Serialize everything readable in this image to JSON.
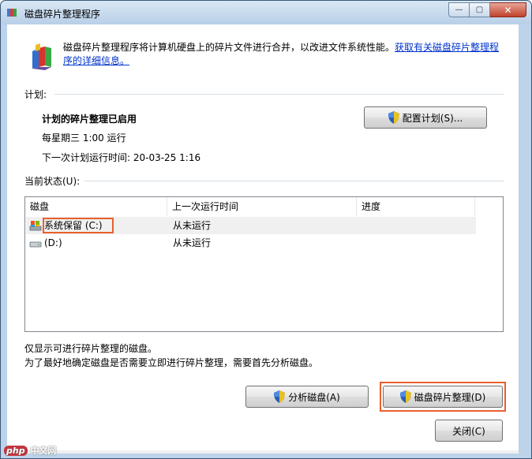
{
  "window": {
    "title": "磁盘碎片整理程序",
    "close_glyph": "✕",
    "min_glyph": "—",
    "max_glyph": "▢"
  },
  "intro": {
    "description": "磁盘碎片整理程序将计算机硬盘上的碎片文件进行合并，以改进文件系统性能。",
    "link": "获取有关磁盘碎片整理程序的详细信息。"
  },
  "schedule": {
    "group_label": "计划:",
    "status": "计划的碎片整理已启用",
    "frequency": "每星期三  1:00 运行",
    "next_run": "下一次计划运行时间: 20-03-25 1:16",
    "configure_button": "配置计划(S)..."
  },
  "current_status": {
    "group_label": "当前状态(U):",
    "columns": [
      "磁盘",
      "上一次运行时间",
      "进度"
    ],
    "rows": [
      {
        "disk": "系统保留 (C:)",
        "last_run": "从未运行",
        "progress": ""
      },
      {
        "disk": "(D:)",
        "last_run": "从未运行",
        "progress": ""
      }
    ]
  },
  "notes": {
    "line1": "仅显示可进行碎片整理的磁盘。",
    "line2": "为了最好地确定磁盘是否需要立即进行碎片整理，需要首先分析磁盘。"
  },
  "actions": {
    "analyze_button": "分析磁盘(A)",
    "defrag_button": "磁盘碎片整理(D)",
    "close_button": "关闭(C)"
  },
  "watermark": {
    "badge": "php",
    "text": "中文网"
  },
  "colors": {
    "highlight": "#e8602c",
    "link": "#0033cc"
  }
}
